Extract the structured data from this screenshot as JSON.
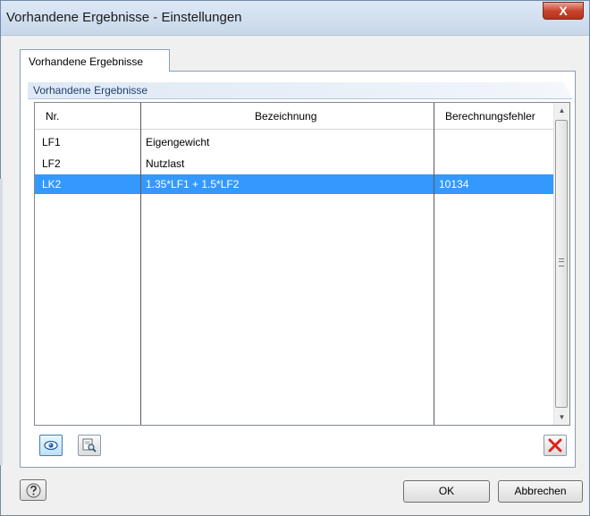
{
  "window": {
    "title": "Vorhandene Ergebnisse - Einstellungen",
    "close_label": "X"
  },
  "tabs": [
    {
      "label": "Vorhandene Ergebnisse",
      "active": true
    }
  ],
  "section": {
    "title": "Vorhandene Ergebnisse"
  },
  "table": {
    "columns": [
      "Nr.",
      "Bezeichnung",
      "Berechnungsfehler"
    ],
    "rows": [
      {
        "nr": "LF1",
        "bezeichnung": "Eigengewicht",
        "fehler": "",
        "selected": false
      },
      {
        "nr": "LF2",
        "bezeichnung": "Nutzlast",
        "fehler": "",
        "selected": false
      },
      {
        "nr": "LK2",
        "bezeichnung": "1.35*LF1 + 1.5*LF2",
        "fehler": "10134",
        "selected": true
      }
    ]
  },
  "toolbar": {
    "view_icon": "eye-icon",
    "preview_icon": "magnifier-icon",
    "delete_icon": "red-x-icon"
  },
  "buttons": {
    "help_icon": "help-icon",
    "ok": "OK",
    "cancel": "Abbrechen"
  },
  "colors": {
    "selection": "#3399ff",
    "section_title": "#1f3f6e",
    "delete": "#d9261c"
  }
}
